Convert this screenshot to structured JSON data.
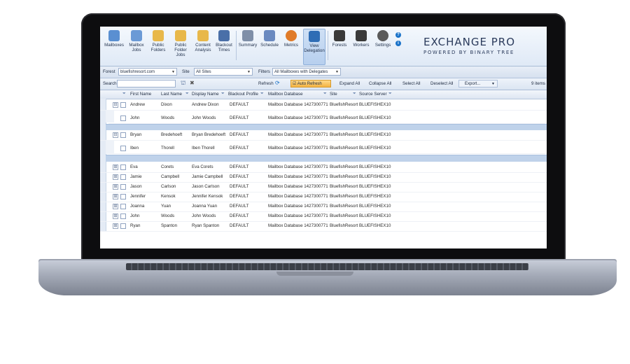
{
  "ribbon": {
    "buttons": [
      {
        "label": "Mailboxes",
        "icon": "mailbox-icon",
        "color": "#5a8fd1"
      },
      {
        "label": "Mailbox Jobs",
        "icon": "mailbox-jobs-icon",
        "color": "#6b9ad6"
      },
      {
        "label": "Public Folders",
        "icon": "public-folders-icon",
        "color": "#e8b84a"
      },
      {
        "label": "Public Folder Jobs",
        "icon": "public-folder-jobs-icon",
        "color": "#e8b84a"
      },
      {
        "label": "Content Analysis",
        "icon": "content-analysis-icon",
        "color": "#e8b84a"
      },
      {
        "label": "Blackout Times",
        "icon": "blackout-times-icon",
        "color": "#4a6fa8"
      },
      {
        "label": "Summary",
        "icon": "summary-icon",
        "color": "#7f8fa8"
      },
      {
        "label": "Schedule",
        "icon": "schedule-icon",
        "color": "#6b8ac0"
      },
      {
        "label": "Metrics",
        "icon": "metrics-icon",
        "color": "#e07b2a"
      },
      {
        "label": "View Delegation",
        "icon": "delegation-icon",
        "color": "#2f6db5"
      },
      {
        "label": "Forests",
        "icon": "forests-icon",
        "color": "#3a3a3a"
      },
      {
        "label": "Workers",
        "icon": "workers-icon",
        "color": "#3a3a3a"
      },
      {
        "label": "Settings",
        "icon": "gear-icon",
        "color": "#5a5a5a"
      }
    ],
    "help_glyph": "?",
    "info_glyph": "i"
  },
  "brand": {
    "title": "EXCHANGE PRO",
    "subtitle": "POWERED BY BINARY TREE"
  },
  "filters": {
    "forest_label": "Forest",
    "forest_value": "bluefishresort.com",
    "site_label": "Site",
    "site_value": "All Sites",
    "filters_label": "Filters",
    "filters_value": "All Mailboxes with Delegates"
  },
  "toolbar": {
    "search_label": "Search",
    "refresh_label": "Refresh",
    "auto_refresh_label": "Auto Refresh",
    "expand_all": "Expand All",
    "collapse_all": "Collapse All",
    "select_all": "Select All",
    "deselect_all": "Deselect All",
    "export": "Export...",
    "item_count": "9 items"
  },
  "grid": {
    "columns": [
      "First Name",
      "Last Name",
      "Display Name",
      "Blackout Profile",
      "Mailbox Database",
      "Site",
      "Source Server"
    ],
    "rows": [
      {
        "expander": "⊟",
        "first": "Andrew",
        "last": "Dixon",
        "display": "Andrew Dixon",
        "profile": "DEFAULT",
        "db": "Mailbox Database 1427300771",
        "site": "BluefishResort",
        "server": "BLUEFISHEX10"
      },
      {
        "expander": "",
        "first": "John",
        "last": "Woods",
        "display": "John Woods",
        "profile": "DEFAULT",
        "db": "Mailbox Database 1427300771",
        "site": "BluefishResort",
        "server": "BLUEFISHEX10"
      },
      {
        "expander": "⊟",
        "first": "Bryan",
        "last": "Bredehoeft",
        "display": "Bryan Bredehoeft",
        "profile": "DEFAULT",
        "db": "Mailbox Database 1427300771",
        "site": "BluefishResort",
        "server": "BLUEFISHEX10"
      },
      {
        "expander": "",
        "first": "Iben",
        "last": "Thorell",
        "display": "Iben Thorell",
        "profile": "DEFAULT",
        "db": "Mailbox Database 1427300771",
        "site": "BluefishResort",
        "server": "BLUEFISHEX10"
      },
      {
        "expander": "⊞",
        "first": "Eva",
        "last": "Corets",
        "display": "Eva Corets",
        "profile": "DEFAULT",
        "db": "Mailbox Database 1427300771",
        "site": "BluefishResort",
        "server": "BLUEFISHEX10"
      },
      {
        "expander": "⊞",
        "first": "Jamie",
        "last": "Campbell",
        "display": "Jamie Campbell",
        "profile": "DEFAULT",
        "db": "Mailbox Database 1427300771",
        "site": "BluefishResort",
        "server": "BLUEFISHEX10"
      },
      {
        "expander": "⊞",
        "first": "Jason",
        "last": "Carlson",
        "display": "Jason Carlson",
        "profile": "DEFAULT",
        "db": "Mailbox Database 1427300771",
        "site": "BluefishResort",
        "server": "BLUEFISHEX10"
      },
      {
        "expander": "⊞",
        "first": "Jennifer",
        "last": "Kensok",
        "display": "Jennifer Kensok",
        "profile": "DEFAULT",
        "db": "Mailbox Database 1427300771",
        "site": "BluefishResort",
        "server": "BLUEFISHEX10"
      },
      {
        "expander": "⊞",
        "first": "Joanna",
        "last": "Yuan",
        "display": "Joanna Yuan",
        "profile": "DEFAULT",
        "db": "Mailbox Database 1427300771",
        "site": "BluefishResort",
        "server": "BLUEFISHEX10"
      },
      {
        "expander": "⊞",
        "first": "John",
        "last": "Woods",
        "display": "John Woods",
        "profile": "DEFAULT",
        "db": "Mailbox Database 1427300771",
        "site": "BluefishResort",
        "server": "BLUEFISHEX10"
      },
      {
        "expander": "⊞",
        "first": "Ryan",
        "last": "Spanton",
        "display": "Ryan Spanton",
        "profile": "DEFAULT",
        "db": "Mailbox Database 1427300771",
        "site": "BluefishResort",
        "server": "BLUEFISHEX10"
      }
    ]
  }
}
